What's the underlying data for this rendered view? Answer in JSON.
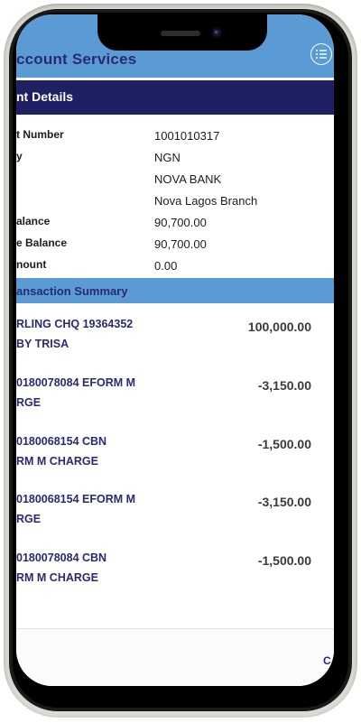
{
  "header": {
    "title": "ccount Services",
    "menu_icon": "menu-list-icon",
    "background": "#5b9bd5"
  },
  "details": {
    "title": "nt Details",
    "rows": [
      {
        "label": "t Number",
        "value": "1001010317"
      },
      {
        "label": "y",
        "value": "NGN"
      },
      {
        "label": "",
        "value": "NOVA BANK"
      },
      {
        "label": "",
        "value": "Nova Lagos Branch"
      },
      {
        "label": "alance",
        "value": "90,700.00"
      },
      {
        "label": "e Balance",
        "value": "90,700.00"
      },
      {
        "label": "nount",
        "value": "0.00"
      }
    ]
  },
  "summary": {
    "title": "ansaction Summary",
    "transactions": [
      {
        "line1": "RLING CHQ 19364352",
        "line2": "BY TRISA",
        "amount": "100,000.00"
      },
      {
        "line1": "0180078084 EFORM M",
        "line2": "RGE",
        "amount": "-3,150.00"
      },
      {
        "line1": "0180068154 CBN",
        "line2": "RM M CHARGE",
        "amount": "-1,500.00"
      },
      {
        "line1": "0180068154 EFORM M",
        "line2": "RGE",
        "amount": "-3,150.00"
      },
      {
        "line1": "0180078084 CBN",
        "line2": "RM M CHARGE",
        "amount": "-1,500.00"
      }
    ]
  },
  "footer": {
    "close_label": "C"
  },
  "colors": {
    "accent": "#5b9bd5",
    "navy": "#1f1f63",
    "text_navy": "#2a2a72"
  }
}
